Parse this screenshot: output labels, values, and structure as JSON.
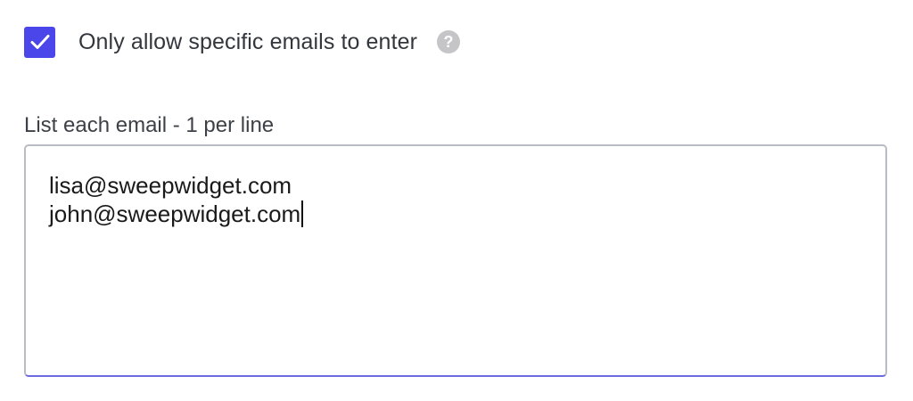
{
  "access": {
    "restrict_checkbox": {
      "checked": true,
      "label": "Only allow specific emails to enter"
    },
    "help_icon": {
      "glyph": "?",
      "icon": "question-circle-icon"
    },
    "emails_field": {
      "label": "List each email - 1 per line",
      "lines": [
        "lisa@sweepwidget.com",
        "john@sweepwidget.com"
      ]
    }
  },
  "colors": {
    "accent": "#4a46ea",
    "text": "#33373d",
    "help_icon_bg": "#c5c5c8",
    "focus_border": "#6d6ae0"
  }
}
